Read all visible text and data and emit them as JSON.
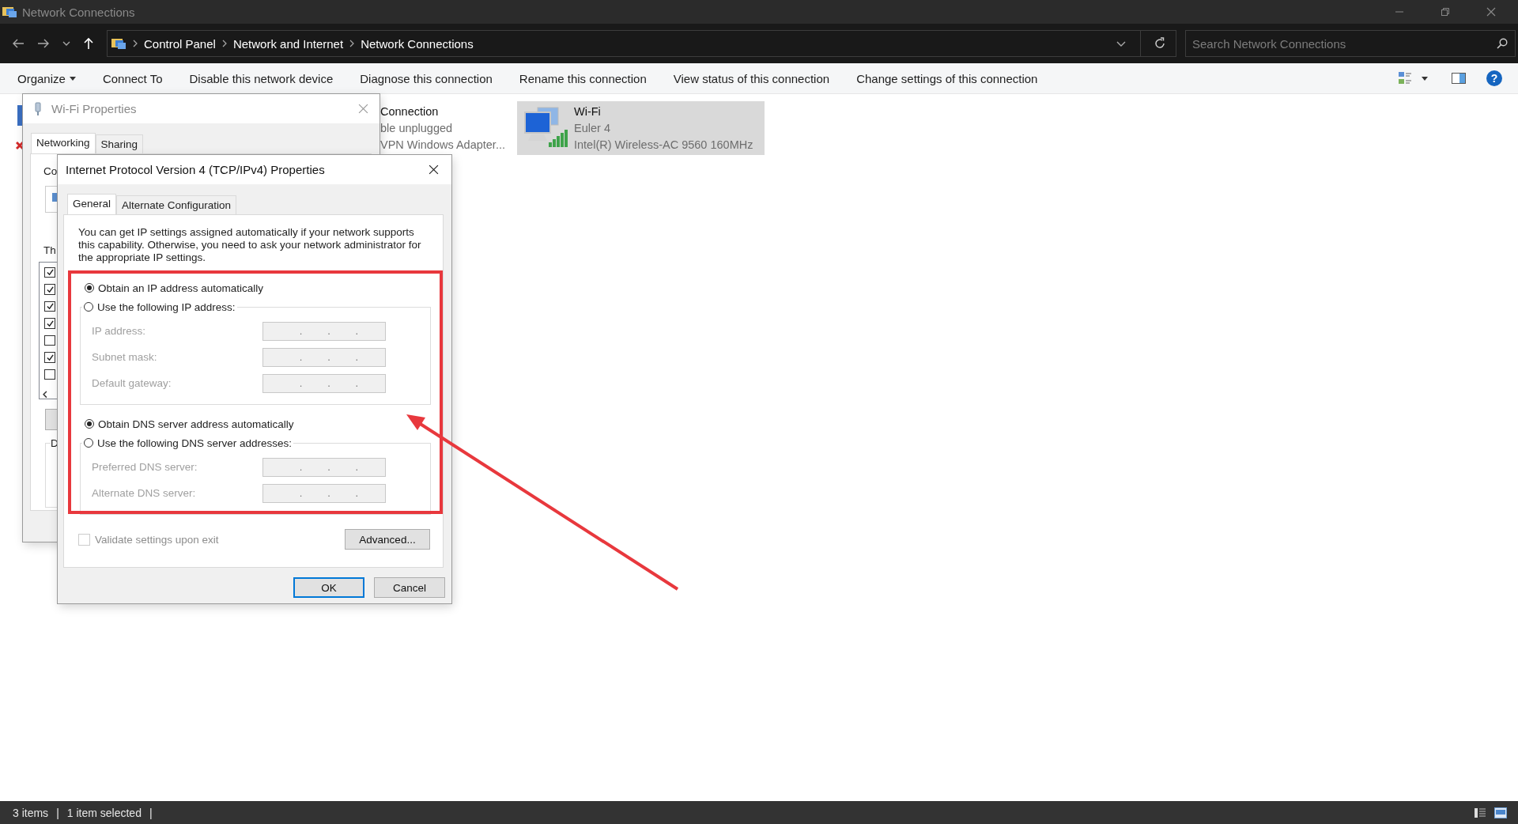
{
  "window": {
    "title": "Network Connections"
  },
  "address_bar": {
    "path": [
      "Control Panel",
      "Network and Internet",
      "Network Connections"
    ]
  },
  "search": {
    "placeholder": "Search Network Connections"
  },
  "toolbar": {
    "items": [
      {
        "label": "Organize",
        "dropdown": true
      },
      {
        "label": "Connect To",
        "dropdown": false
      },
      {
        "label": "Disable this network device",
        "dropdown": false
      },
      {
        "label": "Diagnose this connection",
        "dropdown": false
      },
      {
        "label": "Rename this connection",
        "dropdown": false
      },
      {
        "label": "View status of this connection",
        "dropdown": false
      },
      {
        "label": "Change settings of this connection",
        "dropdown": false
      }
    ],
    "help_glyph": "?"
  },
  "connections": [
    {
      "name": "Connection",
      "status": "ble unplugged",
      "device": "VPN Windows Adapter...",
      "selected": false
    },
    {
      "name": "Wi-Fi",
      "status": "Euler 4",
      "device": "Intel(R) Wireless-AC 9560 160MHz",
      "selected": true
    }
  ],
  "wifi_properties": {
    "title": "Wi-Fi Properties",
    "tabs": [
      {
        "label": "Networking",
        "selected": true
      },
      {
        "label": "Sharing",
        "selected": false
      }
    ],
    "connect_using_label": "Co",
    "components_label": "Th",
    "description_label": "D",
    "components": [
      {
        "checked": true
      },
      {
        "checked": true
      },
      {
        "checked": true
      },
      {
        "checked": true
      },
      {
        "checked": false
      },
      {
        "checked": true
      },
      {
        "checked": false
      }
    ]
  },
  "ipv4_properties": {
    "title": "Internet Protocol Version 4 (TCP/IPv4) Properties",
    "tabs": [
      {
        "label": "General",
        "selected": true
      },
      {
        "label": "Alternate Configuration",
        "selected": false
      }
    ],
    "intro": "You can get IP settings assigned automatically if your network supports this capability. Otherwise, you need to ask your network administrator for the appropriate IP settings.",
    "ip_options": [
      {
        "label": "Obtain an IP address automatically",
        "selected": true
      },
      {
        "label": "Use the following IP address:",
        "selected": false
      }
    ],
    "ip_fields_disabled": true,
    "ip_fields": [
      {
        "label": "IP address:",
        "dots": [
          ".",
          ".",
          "."
        ]
      },
      {
        "label": "Subnet mask:",
        "dots": [
          ".",
          ".",
          "."
        ]
      },
      {
        "label": "Default gateway:",
        "dots": [
          ".",
          ".",
          "."
        ]
      }
    ],
    "dns_options": [
      {
        "label": "Obtain DNS server address automatically",
        "selected": true
      },
      {
        "label": "Use the following DNS server addresses:",
        "selected": false
      }
    ],
    "dns_fields_disabled": true,
    "dns_fields": [
      {
        "label": "Preferred DNS server:",
        "dots": [
          ".",
          ".",
          "."
        ]
      },
      {
        "label": "Alternate DNS server:",
        "dots": [
          ".",
          ".",
          "."
        ]
      }
    ],
    "validate": {
      "label": "Validate settings upon exit",
      "checked": false,
      "disabled": true
    },
    "advanced_button": "Advanced...",
    "buttons": [
      {
        "label": "OK",
        "default": true
      },
      {
        "label": "Cancel",
        "default": false
      }
    ]
  },
  "status_bar": {
    "items": [
      "3 items",
      "1 item selected"
    ],
    "separator": "|"
  }
}
